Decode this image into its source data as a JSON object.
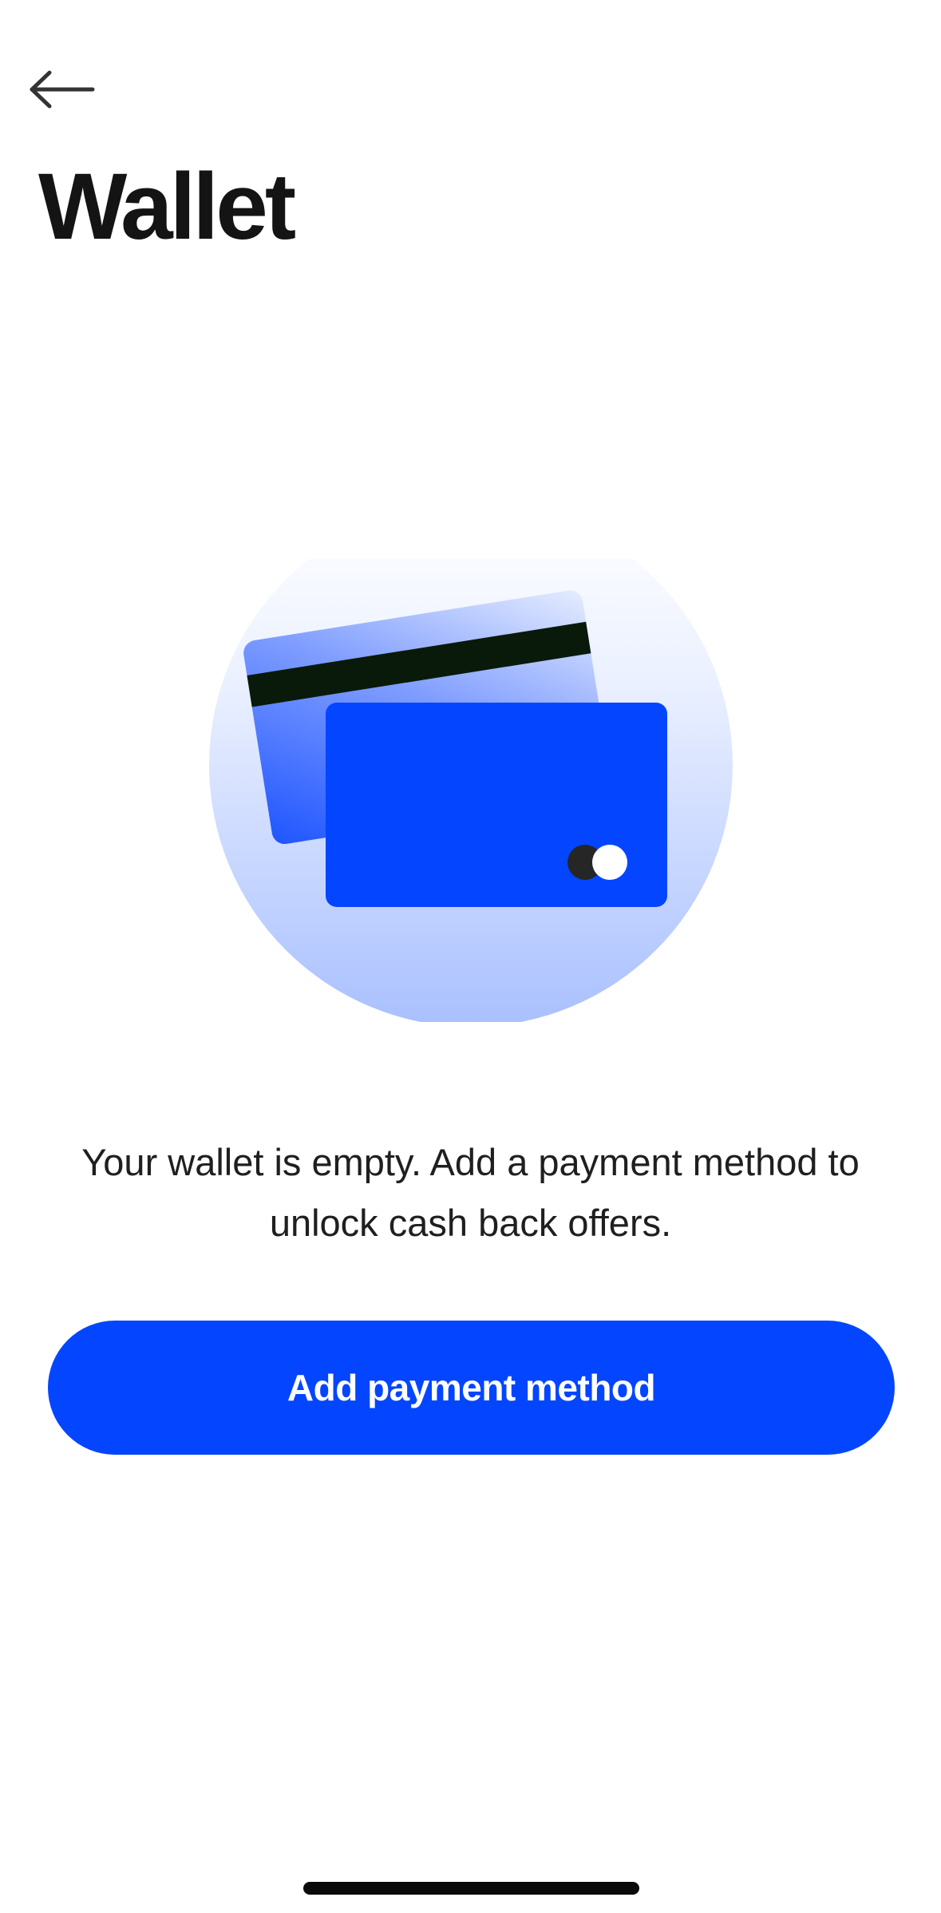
{
  "header": {
    "back_icon": "arrow-left-icon",
    "title": "Wallet"
  },
  "illustration": {
    "icon": "credit-cards-icon",
    "colors": {
      "circle_top": "#ffffff",
      "circle_bottom": "#a9c0ff",
      "card_front": "#0446ff",
      "card_back": "#3d6bff",
      "stripe": "#0a1a0a"
    }
  },
  "empty_state": {
    "message": "Your wallet is empty. Add a payment method to unlock cash back offers."
  },
  "actions": {
    "add_payment_label": "Add payment method"
  },
  "theme": {
    "accent": "#0446ff",
    "text": "#141414",
    "background": "#ffffff"
  }
}
